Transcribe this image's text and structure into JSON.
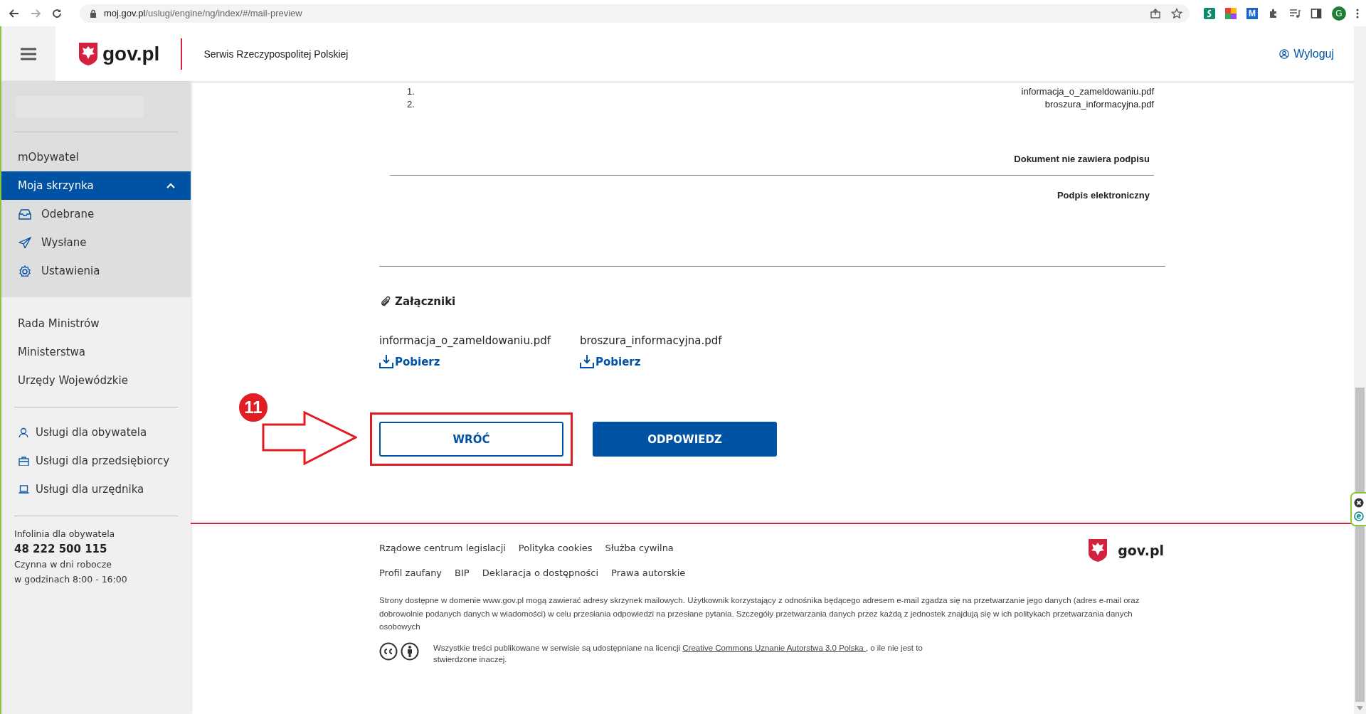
{
  "browser": {
    "url_domain": "moj.gov.pl",
    "url_path": "/uslugi/engine/ng/index/#/mail-preview",
    "extension_letter": "M",
    "profile_initial": "G"
  },
  "header": {
    "logo": "gov.pl",
    "service": "Serwis Rzeczypospolitej Polskiej",
    "logout": "Wyloguj"
  },
  "sidebar": {
    "top_items": [
      {
        "label": "mObywatel",
        "selected": false
      },
      {
        "label": "Moja skrzynka",
        "selected": true,
        "expanded": true,
        "children": [
          {
            "label": "Odebrane"
          },
          {
            "label": "Wysłane"
          },
          {
            "label": "Ustawienia"
          }
        ]
      }
    ],
    "links": [
      "Rada Ministrów",
      "Ministerstwa",
      "Urzędy Wojewódzkie"
    ],
    "services": [
      {
        "label": "Usługi dla obywatela"
      },
      {
        "label": "Usługi dla przedsiębiorcy"
      },
      {
        "label": "Usługi dla urzędnika"
      }
    ],
    "helpline": {
      "title": "Infolinia dla obywatela",
      "phone": "48 222 500 115",
      "hours": [
        "Czynna w dni robocze",
        "w godzinach 8:00 - 16:00"
      ]
    }
  },
  "document": {
    "attachment_list": [
      {
        "number": "1.",
        "name": "informacja_o_zameldowaniu.pdf"
      },
      {
        "number": "2.",
        "name": "broszura_informacyjna.pdf"
      }
    ],
    "signature_status": "Dokument nie zawiera podpisu",
    "signature_heading": "Podpis elektroniczny"
  },
  "attachments": {
    "title": "Załączniki",
    "files": [
      {
        "name": "informacja_o_zameldowaniu.pdf",
        "download": "Pobierz"
      },
      {
        "name": "broszura_informacyjna.pdf",
        "download": "Pobierz"
      }
    ]
  },
  "buttons": [
    {
      "label": "WRÓĆ",
      "kind": "secondary"
    },
    {
      "label": "ODPOWIEDZ",
      "kind": "primary"
    }
  ],
  "annotation": {
    "number": "11"
  },
  "footer": {
    "link_rows": [
      [
        "Rządowe centrum legislacji",
        "Polityka cookies",
        "Służba cywilna"
      ],
      [
        "Profil zaufany",
        "BIP",
        "Deklaracja o dostępności",
        "Prawa autorskie"
      ]
    ],
    "logo": "gov.pl",
    "disclaimer": "Strony dostępne w domenie www.gov.pl mogą zawierać adresy skrzynek mailowych. Użytkownik korzystający z odnośnika będącego adresem e-mail zgadza się na przetwarzanie jego danych (adres e-mail oraz dobrowolnie podanych danych w wiadomości) w celu przesłania odpowiedzi na przesłane pytania. Szczegóły przetwarzania danych przez każdą z jednostek znajdują się w ich politykach przetwarzania danych osobowych",
    "license_before": "Wszystkie treści publikowane w serwisie są udostępniane na licencji ",
    "license_link": "Creative Commons Uznanie Autorstwa 3.0 Polska ",
    "license_after": ", o ile nie jest to stwierdzone inaczej."
  }
}
